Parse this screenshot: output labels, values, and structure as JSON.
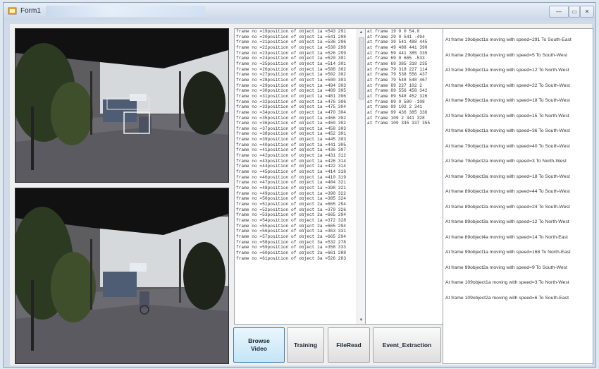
{
  "window": {
    "title": "Form1",
    "controls": {
      "minimize": "—",
      "maximize": "▭",
      "close": "✕"
    }
  },
  "colors": {
    "titlebar": "#cbd8e8",
    "panel": "#f0f0f0",
    "active_button": "#c4e5f6"
  },
  "video": {
    "top_name": "detection-view",
    "bottom_name": "source-view"
  },
  "positions_list": [
    "frame no =19position of object 1a =543  291",
    "frame no =20position of object 1a =541  298",
    "frame no =21position of object 1a =536  296",
    "frame no =22position of object 1a =530  298",
    "frame no =23position of object 1a =526  299",
    "frame no =24position of object 1a =520  301",
    "frame no =25position of object 1a =514  301",
    "frame no =26position of object 1a =508  302",
    "frame no =27position of object 1a =502  302",
    "frame no =28position of object 1a =500  303",
    "frame no =29position of object 1a =494  303",
    "frame no =30position of object 1a =489  305",
    "frame no =31position of object 1a =481  306",
    "frame no =32position of object 1a =476  306",
    "frame no =33position of object 1a =475  304",
    "frame no =34position of object 1a =470  304",
    "frame no =35position of object 1a =466  302",
    "frame no =36position of object 1a =460  302",
    "frame no =37position of object 1a =458  303",
    "frame no =38position of object 1a =452  301",
    "frame no =39position of object 1a =445  303",
    "frame no =40position of object 1a =441  305",
    "frame no =41position of object 1a =436  307",
    "frame no =42position of object 1a =431  312",
    "frame no =43position of object 1a =426  314",
    "frame no =44position of object 1a =422  314",
    "frame no =45position of object 1a =414  318",
    "frame no =46position of object 1a =410  319",
    "frame no =47position of object 1a =404  321",
    "frame no =48position of object 1a =398  321",
    "frame no =49position of object 1a =390  322",
    "frame no =50position of object 1a =385  324",
    "frame no =51position of object 2a =665  294",
    "frame no =52position of object 1a =379  326",
    "frame no =53position of object 2a =665  294",
    "frame no =54position of object 1a =372  328",
    "frame no =55position of object 2a =665  294",
    "frame no =56position of object 1a =363  331",
    "frame no =57position of object 2a =665  294",
    "frame no =58position of object 3a =532  278",
    "frame no =59position of object 1a =358  333",
    "frame no =60position of object 2a =661  288",
    "frame no =61position of object 3a =526  283"
  ],
  "frames_list": [
    "at frame   19  0   0   54.0",
    "at frame   29  0   541   -494",
    "at frame   39  541   488   445",
    "at frame   49  488   441   390",
    "at frame   59  441   385   335",
    "at frame   69  0   665   -533",
    "at frame   69  385   318   235",
    "at frame   79  318   227   114",
    "at frame   79  538   556   437",
    "at frame   79  548   548   467",
    "at frame   89  227   102   2",
    "at frame   89  556   458   342",
    "at frame   89  548   452   326",
    "at frame   89  0   500   -108",
    "at frame   99  102   2   341",
    "at frame   99  436   385   336",
    "at frame   109  2   341   328",
    "at frame   109  345   337   355"
  ],
  "events_list": [
    "At frame   19object1a moving with speed=291 To South-East",
    "At frame   29object1a moving with speed=5 To South-West",
    "At frame   39object1a moving with speed=12 To North-West",
    "At frame   49object1a moving with speed=22 To South-West",
    "At frame   59object1a moving with speed=18 To South-West",
    "At frame   59object2a moving with speed=15 To North-West",
    "At frame   69object1a moving with speed=36 To South-West",
    "At frame   79object1a moving with speed=40 To South-West",
    "At frame   79object2a moving with speed=3 To  North-West",
    "At frame   79object3a moving with speed=18 To South-West",
    "At frame   89object1a moving with speed=44 To South-West",
    "At frame   89object2a moving with speed=24 To South-West",
    "At frame   89object3a moving with speed=12 To North-West",
    "At frame   89object4a moving with speed=14 To North-East",
    "At frame   99object1a moving with speed=168 To North-East",
    "At frame   99object2a moving with speed=9 To South-West",
    "At frame   109object1a moving with speed=3 To North-West",
    "At frame   109object2a moving with speed=6 To South-East"
  ],
  "buttons": {
    "browse": "Browse Video",
    "training": "Training",
    "fileread": "FileRead",
    "event": "Event_Extraction"
  }
}
